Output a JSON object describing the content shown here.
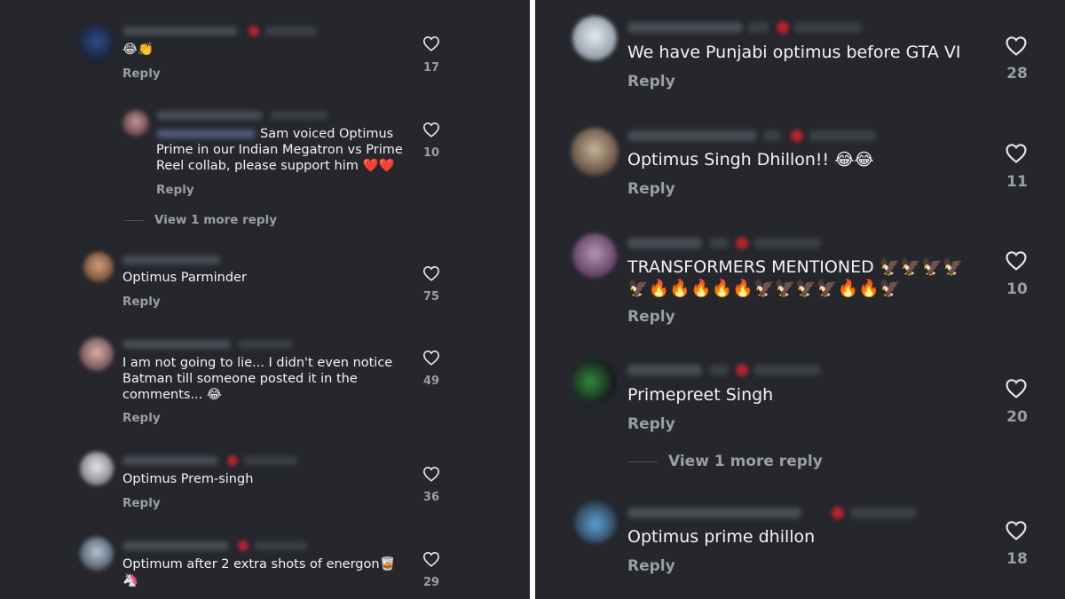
{
  "reply_label": "Reply",
  "colors": {
    "background": "#25272d",
    "text": "#f3f4f6",
    "muted": "#9b9ea6",
    "badge": "#b3232f"
  },
  "left": {
    "comments": [
      {
        "text": "😂👏",
        "likes": "17"
      },
      {
        "text": "Sam voiced Optimus\nPrime in our Indian Megatron vs Prime\nReel collab, please support him ❤️❤️",
        "likes": "10",
        "view_more": "View 1 more reply"
      },
      {
        "text": "Optimus Parminder",
        "likes": "75"
      },
      {
        "text": "I am not going to lie... I didn't even notice\nBatman till someone posted it in the\ncomments... 😂",
        "likes": "49"
      },
      {
        "text": "Optimus Prem-singh",
        "likes": "36"
      },
      {
        "text": "Optimum after 2 extra shots of energon🥃\n🦄",
        "likes": "29"
      }
    ]
  },
  "right": {
    "comments": [
      {
        "text": "We have Punjabi optimus before GTA VI",
        "likes": "28"
      },
      {
        "text": "Optimus Singh Dhillon!! 😂😂",
        "likes": "11"
      },
      {
        "text": "TRANSFORMERS MENTIONED 🦅🦅🦅🦅\n🦅🔥🔥🔥🔥🔥🦅🦅🦅🦅🔥🔥🦅",
        "likes": "10"
      },
      {
        "text": "Primepreet Singh",
        "likes": "20",
        "view_more": "View 1 more reply"
      },
      {
        "text": "Optimus prime dhillon",
        "likes": "18"
      }
    ]
  }
}
